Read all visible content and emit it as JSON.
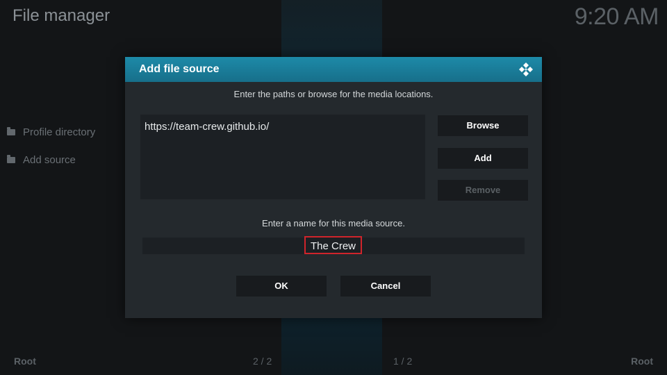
{
  "window": {
    "title": "File manager",
    "clock": "9:20 AM"
  },
  "left_list": {
    "items": [
      {
        "label": "Profile directory",
        "icon": "folder-icon"
      },
      {
        "label": "Add source",
        "icon": "folder-icon"
      }
    ]
  },
  "footer": {
    "left_root": "Root",
    "left_page": "2 / 2",
    "right_page": "1 / 2",
    "right_root": "Root"
  },
  "dialog": {
    "title": "Add file source",
    "logo_icon": "kodi-logo-icon",
    "path_instruction": "Enter the paths or browse for the media locations.",
    "path_value": "https://team-crew.github.io/",
    "buttons": {
      "browse": "Browse",
      "add": "Add",
      "remove": "Remove"
    },
    "name_instruction": "Enter a name for this media source.",
    "name_value": "The Crew",
    "ok": "OK",
    "cancel": "Cancel"
  },
  "colors": {
    "header": "#176f8a",
    "highlight_border": "#d0242b",
    "background": "#131517"
  }
}
